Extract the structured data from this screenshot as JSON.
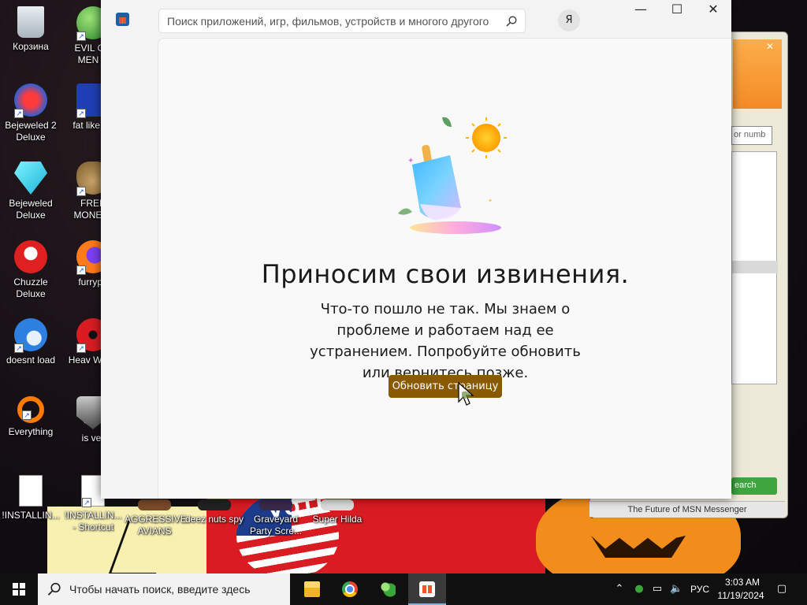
{
  "desktop": {
    "icons_left": [
      {
        "label": "Корзина",
        "icon": "recycle-bin-icon"
      },
      {
        "label": "Bejeweled 2 Deluxe",
        "icon": "bejeweled2-icon"
      },
      {
        "label": "Bejeweled Deluxe",
        "icon": "bejeweled-icon"
      },
      {
        "label": "Chuzzle Deluxe",
        "icon": "chuzzle-icon"
      },
      {
        "label": "doesnt load",
        "icon": "thunderbird-icon"
      },
      {
        "label": "Everything",
        "icon": "everything-icon"
      },
      {
        "label": "!INSTALLIN...",
        "icon": "document-icon"
      }
    ],
    "icons_col2": [
      {
        "label": "EVIL GR MEN C",
        "icon": "msn-people-icon"
      },
      {
        "label": "fat like da",
        "icon": "mp-icon"
      },
      {
        "label": "FREE MONEY..",
        "icon": "money-bag-icon"
      },
      {
        "label": "furrypo",
        "icon": "firefox-icon"
      },
      {
        "label": "Heav Weap",
        "icon": "radiation-icon"
      },
      {
        "label": "is ver",
        "icon": "shield-icon"
      },
      {
        "label": "!INSTALLIN... - Shortcut",
        "icon": "document-icon"
      }
    ],
    "icons_bottom": [
      {
        "label": "AGGRESSIVE AVIANS",
        "icon": "birds-icon"
      },
      {
        "label": "deez nuts spy",
        "icon": "spy-icon"
      },
      {
        "label": "Graveyard Party Scre...",
        "icon": "graveyard-icon"
      },
      {
        "label": "Super Hilda",
        "icon": "hilda-icon"
      }
    ]
  },
  "background_window": {
    "input_fragment": "or numb",
    "search_label": "earch",
    "footer": "The Future of MSN Messenger"
  },
  "store": {
    "search_placeholder": "Поиск приложений, игр, фильмов, устройств и многого другого",
    "avatar_letter": "Я",
    "minimize": "—",
    "maximize": "☐",
    "close": "✕",
    "error_title": "Приносим свои извинения.",
    "error_body": "Что-то пошло не так. Мы знаем о проблеме и работаем над ее устранением. Попробуйте обновить или вернитесь позже.",
    "refresh_button": "Обновить страницу",
    "accent": "#8a5a00"
  },
  "taskbar": {
    "search_placeholder": "Чтобы начать поиск, введите здесь",
    "apps": [
      "file-explorer-icon",
      "chrome-icon",
      "msn-messenger-icon",
      "store-icon"
    ],
    "language": "РУС",
    "time": "3:03 AM",
    "date": "11/19/2024"
  }
}
